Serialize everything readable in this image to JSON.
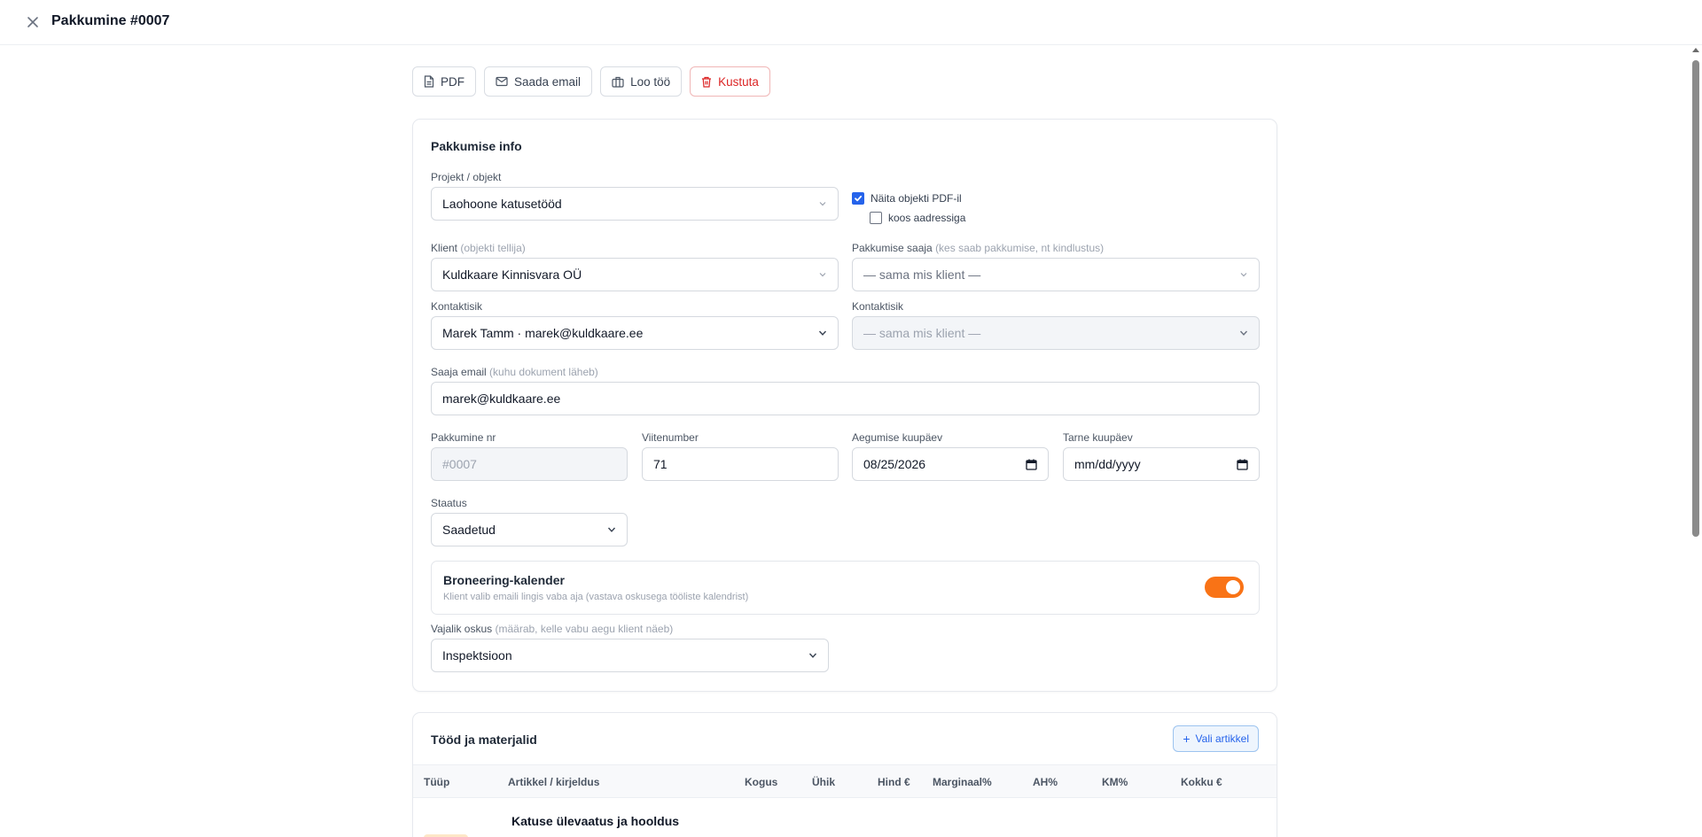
{
  "header": {
    "title": "Pakkumine #0007"
  },
  "actions": {
    "pdf": "PDF",
    "email": "Saada email",
    "job": "Loo töö",
    "delete": "Kustuta"
  },
  "info": {
    "title": "Pakkumise info",
    "project_label": "Projekt / objekt",
    "project_value": "Laohoone katusetööd",
    "show_object_pdf": "Näita objekti PDF-il",
    "with_address": "koos aadressiga",
    "client_label": "Klient",
    "client_hint": "(objekti tellija)",
    "client_value": "Kuldkaare Kinnisvara OÜ",
    "recipient_label": "Pakkumise saaja",
    "recipient_hint": "(kes saab pakkumise, nt kindlustus)",
    "recipient_value": "— sama mis klient —",
    "contact_label": "Kontaktisik",
    "contact_value": "Marek Tamm · marek@kuldkaare.ee",
    "contact2_label": "Kontaktisik",
    "contact2_value": "— sama mis klient —",
    "email_label": "Saaja email",
    "email_hint": "(kuhu dokument läheb)",
    "email_value": "marek@kuldkaare.ee",
    "nr_label": "Pakkumine nr",
    "nr_value": "#0007",
    "ref_label": "Viitenumber",
    "ref_value": "71",
    "expiry_label": "Aegumise kuupäev",
    "expiry_value": "08/25/2026",
    "delivery_label": "Tarne kuupäev",
    "delivery_value": "mm/dd/yyyy",
    "status_label": "Staatus",
    "status_value": "Saadetud",
    "booking_title": "Broneering-kalender",
    "booking_sub": "Klient valib emaili lingis vaba aja (vastava oskusega tööliste kalendrist)",
    "booking_enabled": true,
    "skill_label": "Vajalik oskus",
    "skill_hint": "(määrab, kelle vabu aegu klient näeb)",
    "skill_value": "Inspektsioon"
  },
  "items": {
    "title": "Tööd ja materjalid",
    "add_button": "Vali artikkel",
    "columns": [
      "Tüüp",
      "Artikkel / kirjeldus",
      "Kogus",
      "Ühik",
      "Hind €",
      "Marginaal%",
      "AH%",
      "KM%",
      "Kokku €"
    ],
    "rows": [
      {
        "title": "Katuse ülevaatus ja hooldus"
      }
    ]
  },
  "colors": {
    "accent": "#f97316",
    "primary": "#2563eb",
    "danger": "#dc2626"
  }
}
